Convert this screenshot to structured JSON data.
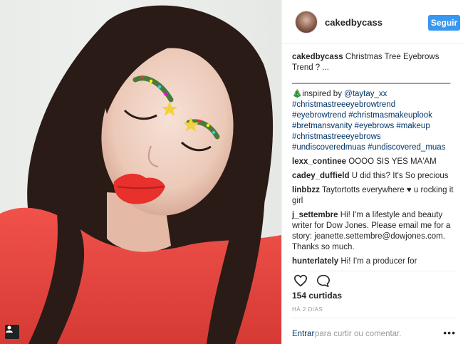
{
  "header": {
    "username": "cakedbycass",
    "follow_label": "Seguir"
  },
  "caption": {
    "username": "cakedbycass",
    "text": "Christmas Tree Eyebrows Trend ? ...",
    "separator": "_________________________________________",
    "tree_emoji": "🎄",
    "inspired_text": "inspired by ",
    "mention": "@taytay_xx",
    "hashtags": [
      "#christmastreeeyebrowtrend",
      "#eyebrowtrend",
      "#christmasmakeuplook",
      "#bretmansvanity",
      "#eyebrows",
      "#makeup",
      "#christmastreeeyebrows",
      "#undiscoveredmuas",
      "#undiscovered_muas"
    ]
  },
  "comments": [
    {
      "user": "lexx_continee",
      "text": "OOOO SIS YES MA'AM"
    },
    {
      "user": "cadey_duffield",
      "text": "U did this? It's So precious"
    },
    {
      "user": "linbbzz",
      "text": "Taytortotts everywhere ♥ u rocking it girl"
    },
    {
      "user": "j_settembre",
      "text": "Hi! I'm a lifestyle and beauty writer for Dow Jones. Please email me for a story: jeanette.settembre@dowjones.com. Thanks so much."
    },
    {
      "user": "hunterlately",
      "text": "Hi! I'm a producer for"
    }
  ],
  "actions": {
    "likes": "154 curtidas",
    "time": "HÁ 2 DIAS"
  },
  "footer": {
    "login_label": "Entrar",
    "rest_text": "para curtir ou comentar.",
    "more_label": "•••"
  },
  "icons": {
    "like": "heart-icon",
    "comment": "comment-icon",
    "post_type": "image-type-icon"
  },
  "colors": {
    "accent": "#3897f0",
    "link": "#003569",
    "lipstick": "#e8302c",
    "shirt": "#e9433e"
  }
}
